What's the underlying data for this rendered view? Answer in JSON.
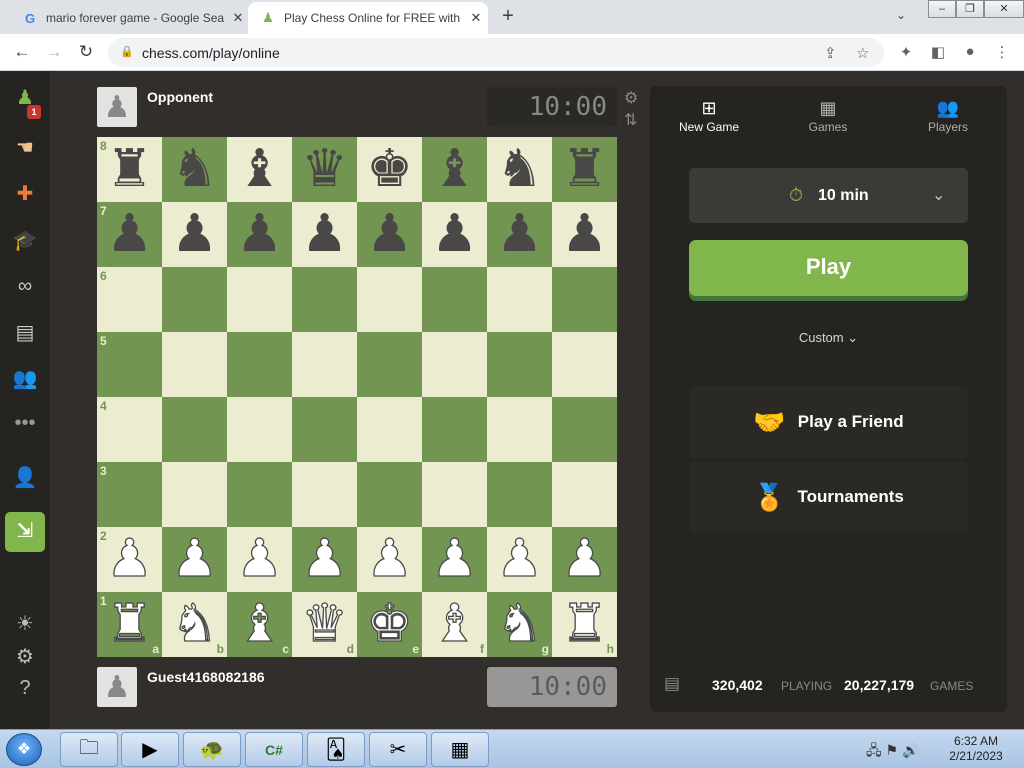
{
  "browser": {
    "tabs": [
      {
        "favicon": "G",
        "title": "mario forever game - Google Search"
      },
      {
        "favicon": "♟",
        "title": "Play Chess Online for FREE with Friends"
      }
    ],
    "new_tab": "+",
    "address": "chess.com/play/online"
  },
  "sidebar": {
    "notification_count": "1",
    "items": [
      "play-icon",
      "puzzles-icon",
      "learn-icon",
      "lessons-icon",
      "watch-icon",
      "news-icon",
      "social-icon",
      "more-icon"
    ],
    "signup_icon": "add-user-icon",
    "login_icon": "login-icon"
  },
  "game": {
    "opponent": {
      "name": "Opponent",
      "clock": "10:00"
    },
    "player": {
      "name": "Guest4168082186",
      "clock": "10:00"
    },
    "board": {
      "ranks": [
        "8",
        "7",
        "6",
        "5",
        "4",
        "3",
        "2",
        "1"
      ],
      "files": [
        "a",
        "b",
        "c",
        "d",
        "e",
        "f",
        "g",
        "h"
      ],
      "position": [
        [
          "r",
          "n",
          "b",
          "q",
          "k",
          "b",
          "n",
          "r"
        ],
        [
          "p",
          "p",
          "p",
          "p",
          "p",
          "p",
          "p",
          "p"
        ],
        [
          "",
          "",
          "",
          "",
          "",
          "",
          "",
          ""
        ],
        [
          "",
          "",
          "",
          "",
          "",
          "",
          "",
          ""
        ],
        [
          "",
          "",
          "",
          "",
          "",
          "",
          "",
          ""
        ],
        [
          "",
          "",
          "",
          "",
          "",
          "",
          "",
          ""
        ],
        [
          "P",
          "P",
          "P",
          "P",
          "P",
          "P",
          "P",
          "P"
        ],
        [
          "R",
          "N",
          "B",
          "Q",
          "K",
          "B",
          "N",
          "R"
        ]
      ]
    }
  },
  "panel": {
    "tabs": [
      {
        "icon": "plus-icon",
        "label": "New Game"
      },
      {
        "icon": "board-icon",
        "label": "Games"
      },
      {
        "icon": "players-icon",
        "label": "Players"
      }
    ],
    "time_control": "10 min",
    "play_label": "Play",
    "custom_label": "Custom",
    "play_friend_label": "Play a Friend",
    "tournaments_label": "Tournaments",
    "stats": {
      "playing_count": "320,402",
      "playing_label": "PLAYING",
      "games_count": "20,227,179",
      "games_label": "GAMES"
    }
  },
  "taskbar": {
    "time": "6:32 AM",
    "date": "2/21/2023"
  },
  "colors": {
    "light_square": "#ebecd0",
    "dark_square": "#739552",
    "accent_green": "#81b64c",
    "background": "#312e2b"
  }
}
